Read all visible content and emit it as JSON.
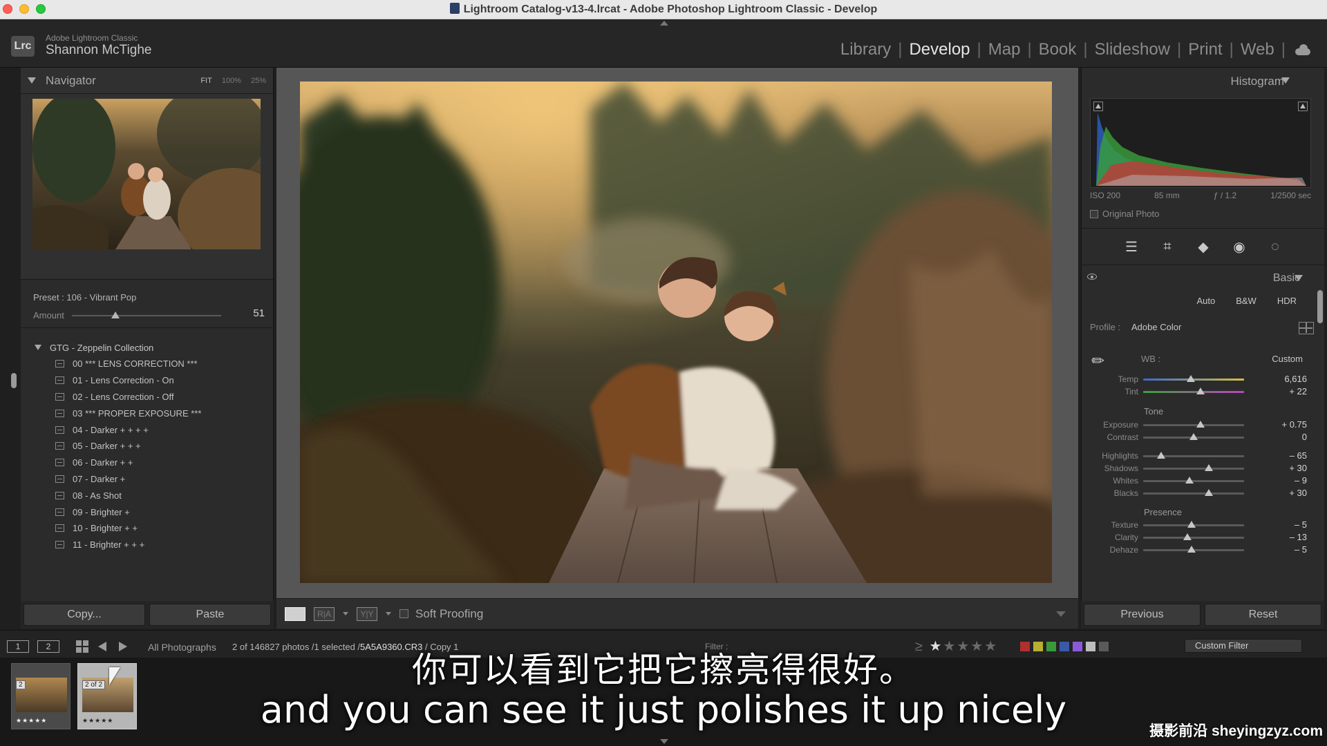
{
  "window": {
    "title": "Lightroom Catalog-v13-4.lrcat - Adobe Photoshop Lightroom Classic - Develop"
  },
  "identity": {
    "badge": "Lrc",
    "product": "Adobe Lightroom Classic",
    "user": "Shannon McTighe"
  },
  "modules": [
    {
      "label": "Library",
      "active": false
    },
    {
      "label": "Develop",
      "active": true
    },
    {
      "label": "Map",
      "active": false
    },
    {
      "label": "Book",
      "active": false
    },
    {
      "label": "Slideshow",
      "active": false
    },
    {
      "label": "Print",
      "active": false
    },
    {
      "label": "Web",
      "active": false
    }
  ],
  "navigator": {
    "title": "Navigator",
    "zoom_options": [
      "FIT",
      "100%",
      "25%"
    ]
  },
  "preset_amount": {
    "preset_label": "Preset : 106 - Vibrant Pop",
    "amount_label": "Amount",
    "amount_value": "51",
    "amount_fraction": 0.29
  },
  "presets": {
    "group": "GTG - Zeppelin Collection",
    "items": [
      "00 *** LENS CORRECTION ***",
      "01 - Lens Correction - On",
      "02 - Lens Correction - Off",
      "03 *** PROPER EXPOSURE ***",
      "04 - Darker + + + +",
      "05 - Darker + + +",
      "06 - Darker + +",
      "07 - Darker +",
      "08 - As Shot",
      "09 - Brighter +",
      "10 - Brighter + +",
      "11 - Brighter + + +"
    ]
  },
  "left_buttons": {
    "copy": "Copy...",
    "paste": "Paste"
  },
  "toolbar": {
    "ra": "R|A",
    "yy": "Y|Y",
    "soft_proofing": "Soft Proofing"
  },
  "histogram": {
    "title": "Histogram",
    "exif": [
      "ISO 200",
      "85 mm",
      "ƒ / 1.2",
      "1/2500 sec"
    ],
    "original_photo": "Original Photo"
  },
  "basic": {
    "title": "Basic",
    "auto": "Auto",
    "bw": "B&W",
    "hdr": "HDR",
    "profile_label": "Profile :",
    "profile_value": "Adobe Color",
    "wb_label": "WB :",
    "wb_value": "Custom",
    "tone_label": "Tone",
    "presence_label": "Presence",
    "sliders": [
      {
        "label": "Temp",
        "value": "6,616",
        "pos": 0.47
      },
      {
        "label": "Tint",
        "value": "+ 22",
        "pos": 0.57
      },
      {
        "label": "Exposure",
        "value": "+ 0.75",
        "pos": 0.57
      },
      {
        "label": "Contrast",
        "value": "0",
        "pos": 0.5
      },
      {
        "label": "Highlights",
        "value": "– 65",
        "pos": 0.18
      },
      {
        "label": "Shadows",
        "value": "+ 30",
        "pos": 0.65
      },
      {
        "label": "Whites",
        "value": "– 9",
        "pos": 0.46
      },
      {
        "label": "Blacks",
        "value": "+ 30",
        "pos": 0.65
      },
      {
        "label": "Texture",
        "value": "– 5",
        "pos": 0.48
      },
      {
        "label": "Clarity",
        "value": "– 13",
        "pos": 0.44
      },
      {
        "label": "Dehaze",
        "value": "– 5",
        "pos": 0.48
      }
    ]
  },
  "right_buttons": {
    "previous": "Previous",
    "reset": "Reset"
  },
  "filmstrip": {
    "mon1": "1",
    "mon2": "2",
    "source": "All Photographs",
    "count_prefix": "2 of 146827 photos /1 selected /",
    "filename": "5A5A9360.CR3",
    "filename_suffix": " / Copy 1",
    "filter_label": "Filter :",
    "stars_prefix": "≥",
    "rating": 1,
    "custom_filter": "Custom Filter",
    "thumbs": [
      {
        "badge": "2",
        "stars": "★★★★★"
      },
      {
        "badge": "2 of 2",
        "stars": "★★★★★"
      }
    ],
    "swatch_colors": [
      "#b03030",
      "#b8b030",
      "#3a9a3a",
      "#3a5aa8",
      "#8a5ad8",
      "#bdbdbd",
      "#5a5a5a"
    ]
  },
  "subtitles": {
    "cn": "你可以看到它把它擦亮得很好。",
    "en": "and you can see it just polishes it up nicely"
  },
  "watermark": "摄影前沿 sheyingzyz.com"
}
